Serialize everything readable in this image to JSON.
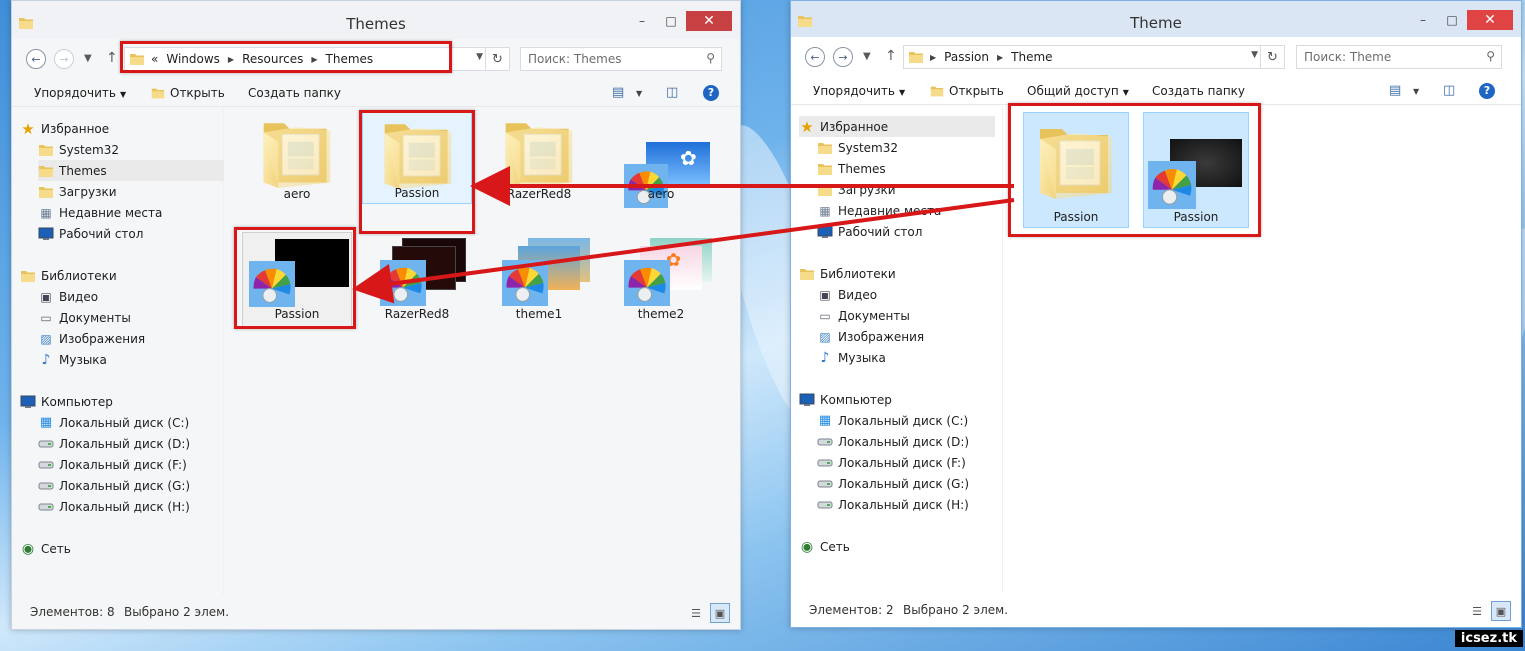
{
  "colors": {
    "highlight": "#d81818",
    "selection": "#cce8ff",
    "accent": "#1f66c4"
  },
  "caption": {
    "minimize": "–",
    "maximize": "□",
    "close": "✕"
  },
  "icons": {
    "folder": "folder-icon",
    "back": "back-arrow-icon",
    "forward": "forward-arrow-icon",
    "up": "up-arrow-icon",
    "refresh": "refresh-icon",
    "search": "search-icon",
    "palette": "theme-palette-icon"
  },
  "left_window": {
    "title": "Themes",
    "address": [
      "«",
      "Windows",
      "Resources",
      "Themes"
    ],
    "search_placeholder": "Поиск: Themes",
    "commands": {
      "organize": "Упорядочить",
      "open": "Открыть",
      "new_folder": "Создать папку"
    },
    "nav": {
      "favorites": "Избранное",
      "favorite_items": [
        "System32",
        "Themes",
        "Загрузки",
        "Недавние места",
        "Рабочий стол"
      ],
      "libraries": "Библиотеки",
      "library_items": [
        "Видео",
        "Документы",
        "Изображения",
        "Музыка"
      ],
      "computer": "Компьютер",
      "drives": [
        "Локальный диск (C:)",
        "Локальный диск (D:)",
        "Локальный диск (F:)",
        "Локальный диск (G:)",
        "Локальный диск (H:)"
      ],
      "network": "Сеть"
    },
    "items": [
      {
        "label": "aero",
        "kind": "folder"
      },
      {
        "label": "Passion",
        "kind": "folder"
      },
      {
        "label": "RazerRed8",
        "kind": "folder"
      },
      {
        "label": "aero",
        "kind": "theme"
      },
      {
        "label": "Passion",
        "kind": "theme"
      },
      {
        "label": "RazerRed8",
        "kind": "theme"
      },
      {
        "label": "theme1",
        "kind": "theme"
      },
      {
        "label": "theme2",
        "kind": "theme"
      }
    ],
    "status": {
      "count": "Элементов: 8",
      "selected": "Выбрано 2 элем."
    }
  },
  "right_window": {
    "title": "Theme",
    "address": [
      "Passion",
      "Theme"
    ],
    "search_placeholder": "Поиск: Theme",
    "commands": {
      "organize": "Упорядочить",
      "open": "Открыть",
      "share": "Общий доступ",
      "new_folder": "Создать папку"
    },
    "nav": {
      "favorites": "Избранное",
      "favorite_items": [
        "System32",
        "Themes",
        "Загрузки",
        "Недавние места",
        "Рабочий стол"
      ],
      "libraries": "Библиотеки",
      "library_items": [
        "Видео",
        "Документы",
        "Изображения",
        "Музыка"
      ],
      "computer": "Компьютер",
      "drives": [
        "Локальный диск (C:)",
        "Локальный диск (D:)",
        "Локальный диск (F:)",
        "Локальный диск (G:)",
        "Локальный диск (H:)"
      ],
      "network": "Сеть"
    },
    "items": [
      {
        "label": "Passion",
        "kind": "folder"
      },
      {
        "label": "Passion",
        "kind": "theme"
      }
    ],
    "status": {
      "count": "Элементов: 2",
      "selected": "Выбрано 2 элем."
    }
  },
  "watermark": "icsez.tk"
}
